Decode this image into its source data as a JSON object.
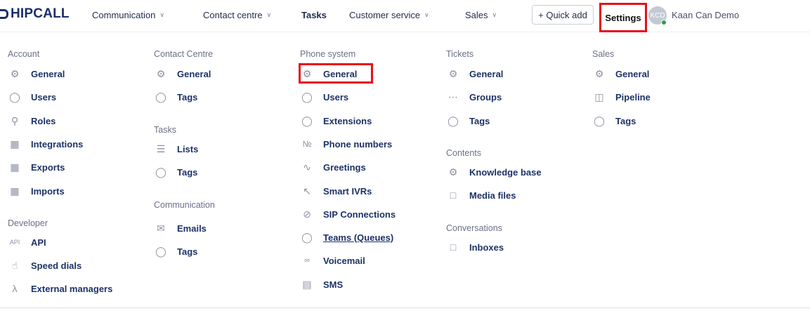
{
  "nav": {
    "logo": "HIPCALL",
    "items": [
      {
        "label": "Communication",
        "chevron": true
      },
      {
        "label": "Contact centre",
        "chevron": true
      },
      {
        "label": "Tasks",
        "chevron": false
      },
      {
        "label": "Customer service",
        "chevron": true
      },
      {
        "label": "Sales",
        "chevron": true
      }
    ],
    "quick_add": "+ Quick add",
    "settings": "Settings",
    "avatar_initials": "KCD",
    "user_name": "Kaan Can Demo"
  },
  "columns": {
    "account": {
      "title": "Account",
      "items": [
        {
          "icon": "gear-icon",
          "label": "General"
        },
        {
          "icon": "user-icon",
          "label": "Users"
        },
        {
          "icon": "key-icon",
          "label": "Roles"
        },
        {
          "icon": "integrations-icon",
          "label": "Integrations"
        },
        {
          "icon": "export-icon",
          "label": "Exports"
        },
        {
          "icon": "import-icon",
          "label": "Imports"
        }
      ]
    },
    "developer": {
      "title": "Developer",
      "items": [
        {
          "icon": "api-icon",
          "label": "API"
        },
        {
          "icon": "speed-dial-icon",
          "label": "Speed dials"
        },
        {
          "icon": "lambda-icon",
          "label": "External managers"
        }
      ]
    },
    "contact_centre": {
      "title": "Contact Centre",
      "items": [
        {
          "icon": "gear-icon",
          "label": "General"
        },
        {
          "icon": "tag-icon",
          "label": "Tags"
        }
      ]
    },
    "tasks": {
      "title": "Tasks",
      "items": [
        {
          "icon": "list-icon",
          "label": "Lists"
        },
        {
          "icon": "tag-icon",
          "label": "Tags"
        }
      ]
    },
    "communication": {
      "title": "Communication",
      "items": [
        {
          "icon": "email-icon",
          "label": "Emails"
        },
        {
          "icon": "tag-icon",
          "label": "Tags"
        }
      ]
    },
    "phone_system": {
      "title": "Phone system",
      "items": [
        {
          "icon": "gear-icon",
          "label": "General"
        },
        {
          "icon": "user-icon",
          "label": "Users"
        },
        {
          "icon": "extension-icon",
          "label": "Extensions"
        },
        {
          "icon": "number-icon",
          "label": "Phone numbers"
        },
        {
          "icon": "greeting-icon",
          "label": "Greetings"
        },
        {
          "icon": "ivr-icon",
          "label": "Smart IVRs"
        },
        {
          "icon": "sip-icon",
          "label": "SIP Connections"
        },
        {
          "icon": "team-icon",
          "label": "Teams (Queues)"
        },
        {
          "icon": "voicemail-icon",
          "label": "Voicemail"
        },
        {
          "icon": "sms-icon",
          "label": "SMS"
        }
      ]
    },
    "tickets": {
      "title": "Tickets",
      "items": [
        {
          "icon": "gear-icon",
          "label": "General"
        },
        {
          "icon": "group-icon",
          "label": "Groups"
        },
        {
          "icon": "tag-icon",
          "label": "Tags"
        }
      ]
    },
    "contents": {
      "title": "Contents",
      "items": [
        {
          "icon": "gear-icon",
          "label": "Knowledge base"
        },
        {
          "icon": "media-icon",
          "label": "Media files"
        }
      ]
    },
    "conversations": {
      "title": "Conversations",
      "items": [
        {
          "icon": "inbox-icon",
          "label": "Inboxes"
        }
      ]
    },
    "sales": {
      "title": "Sales",
      "items": [
        {
          "icon": "gear-icon",
          "label": "General"
        },
        {
          "icon": "pipeline-icon",
          "label": "Pipeline"
        },
        {
          "icon": "tag-icon",
          "label": "Tags"
        }
      ]
    }
  },
  "colors": {
    "accent": "#1c3266",
    "highlight": "#e5101a",
    "online": "#2f9e44"
  }
}
